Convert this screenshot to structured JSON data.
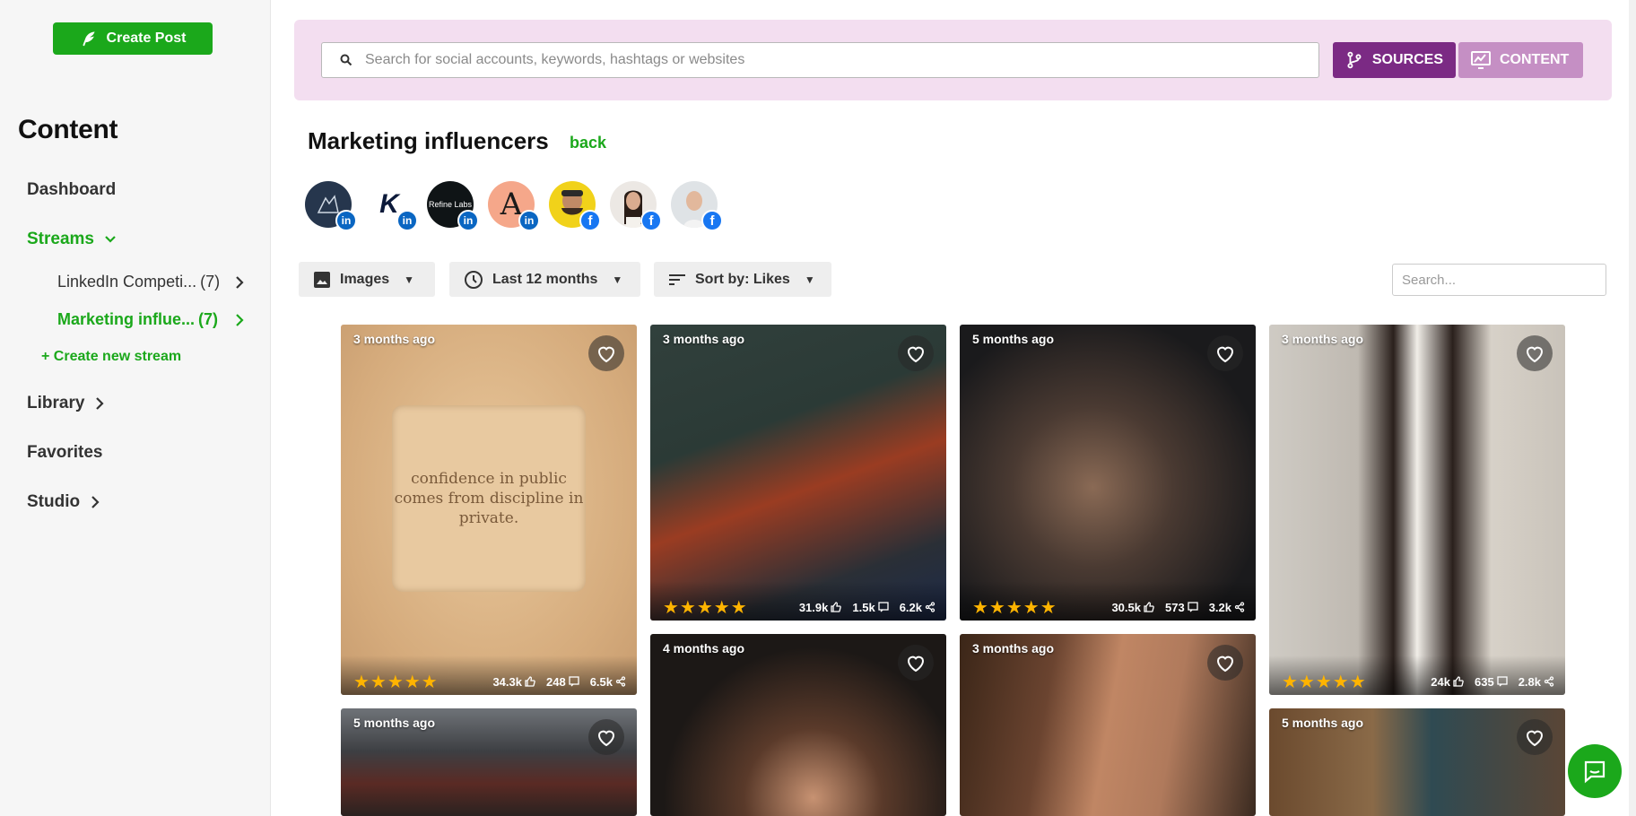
{
  "sidebar": {
    "create_post": "Create Post",
    "title": "Content",
    "nav": {
      "dashboard": "Dashboard",
      "streams": "Streams",
      "library": "Library",
      "favorites": "Favorites",
      "studio": "Studio"
    },
    "streams": [
      {
        "label": "LinkedIn Competi...",
        "count": "(7)"
      },
      {
        "label": "Marketing influe...",
        "count": "(7)"
      }
    ],
    "create_stream": "+ Create new stream"
  },
  "topbar": {
    "search_placeholder": "Search for social accounts, keywords, hashtags or websites",
    "sources": "SOURCES",
    "content": "CONTENT"
  },
  "page": {
    "title": "Marketing influencers",
    "back": "back"
  },
  "avatars": [
    {
      "network": "linkedin",
      "icon": "in"
    },
    {
      "network": "linkedin",
      "icon": "in",
      "text": "K"
    },
    {
      "network": "linkedin",
      "icon": "in",
      "text": "Refine Labs"
    },
    {
      "network": "linkedin",
      "icon": "in",
      "text": "A"
    },
    {
      "network": "facebook",
      "icon": "f"
    },
    {
      "network": "facebook",
      "icon": "f"
    },
    {
      "network": "facebook",
      "icon": "f"
    }
  ],
  "filters": {
    "type": "Images",
    "time": "Last 12 months",
    "sort": "Sort by: Likes",
    "search_placeholder": "Search..."
  },
  "cards": [
    {
      "ago": "3 months ago",
      "stars": "★★★★★",
      "likes": "34.3k",
      "comments": "248",
      "shares": "6.5k",
      "quote": "confidence in public comes from discipline in private."
    },
    {
      "ago": "3 months ago",
      "stars": "★★★★★",
      "likes": "31.9k",
      "comments": "1.5k",
      "shares": "6.2k"
    },
    {
      "ago": "5 months ago",
      "stars": "★★★★★",
      "likes": "30.5k",
      "comments": "573",
      "shares": "3.2k"
    },
    {
      "ago": "3 months ago",
      "stars": "★★★★★",
      "likes": "24k",
      "comments": "635",
      "shares": "2.8k"
    },
    {
      "ago": "5 months ago"
    },
    {
      "ago": "4 months ago"
    },
    {
      "ago": "3 months ago"
    },
    {
      "ago": "5 months ago"
    }
  ],
  "colors": {
    "brand_green": "#1ba81b",
    "sources_purple": "#7b2a84",
    "content_purple": "#c58fc4",
    "topbar_bg": "#f3def0",
    "star": "#ffb400"
  }
}
